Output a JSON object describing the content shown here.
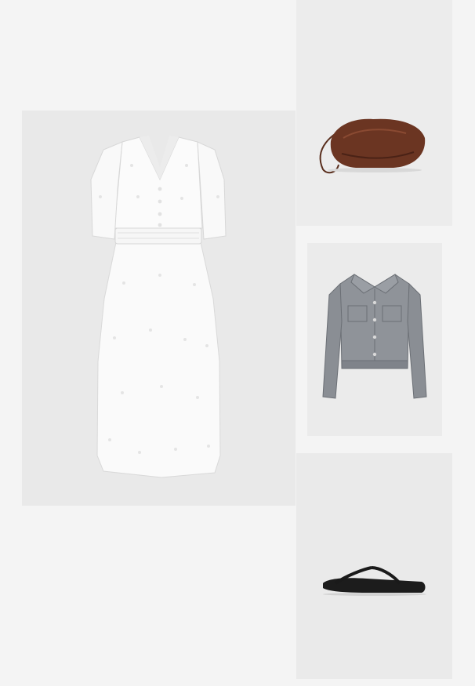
{
  "page": {
    "background": "#f4f4f4"
  },
  "products": [
    {
      "id": "dress",
      "label": "",
      "icon": "white-eyelet-midi-dress",
      "tile_color": "#e9e9e9"
    },
    {
      "id": "bag",
      "label": "",
      "icon": "brown-gathered-clutch-bag",
      "tile_color": "#ececec"
    },
    {
      "id": "jacket",
      "label": "",
      "icon": "grey-denim-cropped-jacket",
      "tile_color": "#ebebeb"
    },
    {
      "id": "sandals",
      "label": "",
      "icon": "black-leather-flip-flop-sandal",
      "tile_color": "#eaeaea"
    }
  ]
}
